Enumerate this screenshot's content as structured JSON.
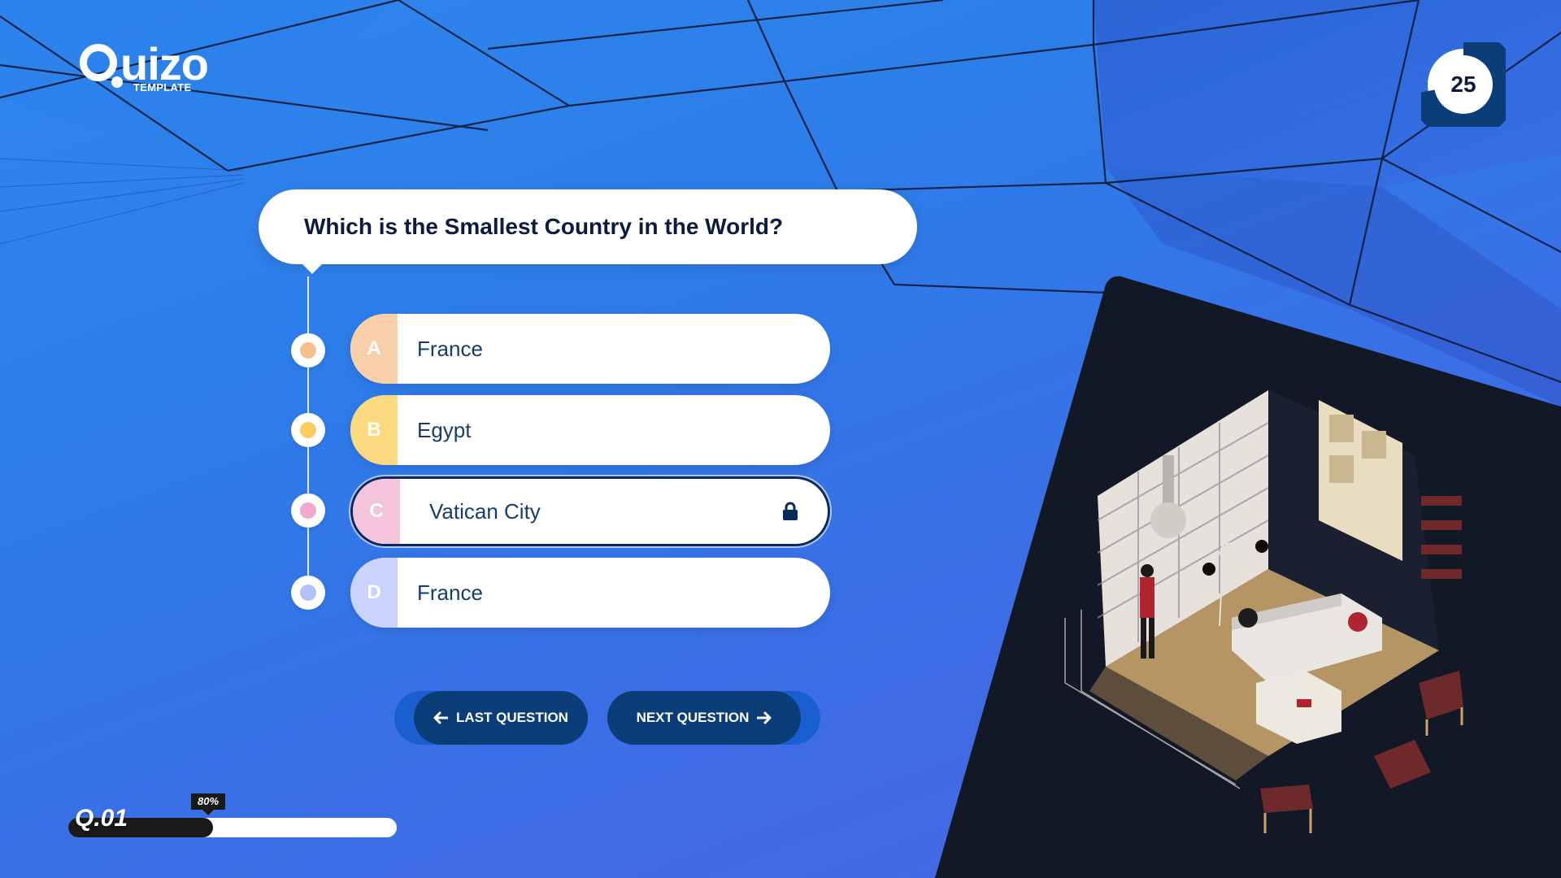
{
  "brand": {
    "logo_word": "uizo",
    "logo_sub": "TEMPLATE"
  },
  "timer": {
    "value": "25",
    "remaining_fraction": 0.72
  },
  "question": {
    "text": "Which is the Smallest Country in the World?"
  },
  "options": [
    {
      "letter": "A",
      "label": "France",
      "color": "#f8cfa8",
      "dot": "#f6c08e",
      "selected": false
    },
    {
      "letter": "B",
      "label": "Egypt",
      "color": "#fbd97f",
      "dot": "#f9cd5f",
      "selected": false
    },
    {
      "letter": "C",
      "label": "Vatican City",
      "color": "#f4c4dd",
      "dot": "#f0a9cd",
      "selected": true
    },
    {
      "letter": "D",
      "label": "France",
      "color": "#c9d3fb",
      "dot": "#b3c1f6",
      "selected": false
    }
  ],
  "navigation": {
    "last_label": "LAST QUESTION",
    "next_label": "NEXT QUESTION"
  },
  "progress": {
    "label": "Q.01",
    "percent": 80,
    "percent_label": "80%"
  },
  "colors": {
    "navy": "#0b3d78",
    "accent_blue": "#1a5fd0",
    "dark_panel": "#131826"
  },
  "icons": {
    "lock": "lock-icon",
    "arrow_left": "arrow-left-icon",
    "arrow_right": "arrow-right-icon"
  }
}
